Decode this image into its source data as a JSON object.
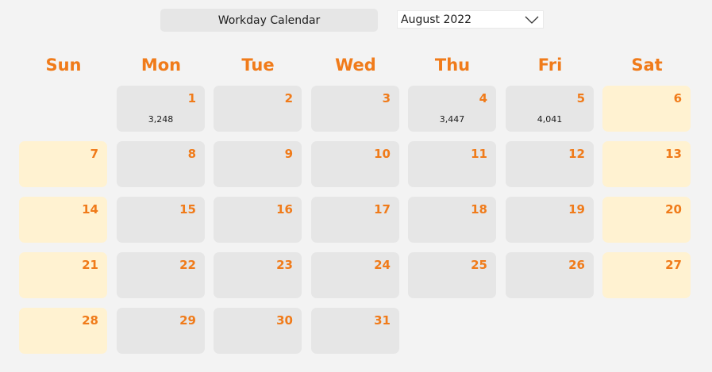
{
  "header": {
    "title": "Workday Calendar",
    "month_selected": "August 2022",
    "dropdown_icon": "chevron-down-icon"
  },
  "colors": {
    "accent": "#f07b1a",
    "weekday_cell": "#e6e6e6",
    "weekend_cell": "#fff2d1",
    "background": "#f3f3f3"
  },
  "weekdays": [
    "Sun",
    "Mon",
    "Tue",
    "Wed",
    "Thu",
    "Fri",
    "Sat"
  ],
  "days": [
    {
      "day": "1",
      "col": 1,
      "week": 0,
      "value": "3,248"
    },
    {
      "day": "2",
      "col": 2,
      "week": 0,
      "value": ""
    },
    {
      "day": "3",
      "col": 3,
      "week": 0,
      "value": ""
    },
    {
      "day": "4",
      "col": 4,
      "week": 0,
      "value": "3,447"
    },
    {
      "day": "5",
      "col": 5,
      "week": 0,
      "value": "4,041"
    },
    {
      "day": "6",
      "col": 6,
      "week": 0,
      "value": ""
    },
    {
      "day": "7",
      "col": 0,
      "week": 1,
      "value": ""
    },
    {
      "day": "8",
      "col": 1,
      "week": 1,
      "value": ""
    },
    {
      "day": "9",
      "col": 2,
      "week": 1,
      "value": ""
    },
    {
      "day": "10",
      "col": 3,
      "week": 1,
      "value": ""
    },
    {
      "day": "11",
      "col": 4,
      "week": 1,
      "value": ""
    },
    {
      "day": "12",
      "col": 5,
      "week": 1,
      "value": ""
    },
    {
      "day": "13",
      "col": 6,
      "week": 1,
      "value": ""
    },
    {
      "day": "14",
      "col": 0,
      "week": 2,
      "value": ""
    },
    {
      "day": "15",
      "col": 1,
      "week": 2,
      "value": ""
    },
    {
      "day": "16",
      "col": 2,
      "week": 2,
      "value": ""
    },
    {
      "day": "17",
      "col": 3,
      "week": 2,
      "value": ""
    },
    {
      "day": "18",
      "col": 4,
      "week": 2,
      "value": ""
    },
    {
      "day": "19",
      "col": 5,
      "week": 2,
      "value": ""
    },
    {
      "day": "20",
      "col": 6,
      "week": 2,
      "value": ""
    },
    {
      "day": "21",
      "col": 0,
      "week": 3,
      "value": ""
    },
    {
      "day": "22",
      "col": 1,
      "week": 3,
      "value": ""
    },
    {
      "day": "23",
      "col": 2,
      "week": 3,
      "value": ""
    },
    {
      "day": "24",
      "col": 3,
      "week": 3,
      "value": ""
    },
    {
      "day": "25",
      "col": 4,
      "week": 3,
      "value": ""
    },
    {
      "day": "26",
      "col": 5,
      "week": 3,
      "value": ""
    },
    {
      "day": "27",
      "col": 6,
      "week": 3,
      "value": ""
    },
    {
      "day": "28",
      "col": 0,
      "week": 4,
      "value": ""
    },
    {
      "day": "29",
      "col": 1,
      "week": 4,
      "value": ""
    },
    {
      "day": "30",
      "col": 2,
      "week": 4,
      "value": ""
    },
    {
      "day": "31",
      "col": 3,
      "week": 4,
      "value": ""
    }
  ]
}
